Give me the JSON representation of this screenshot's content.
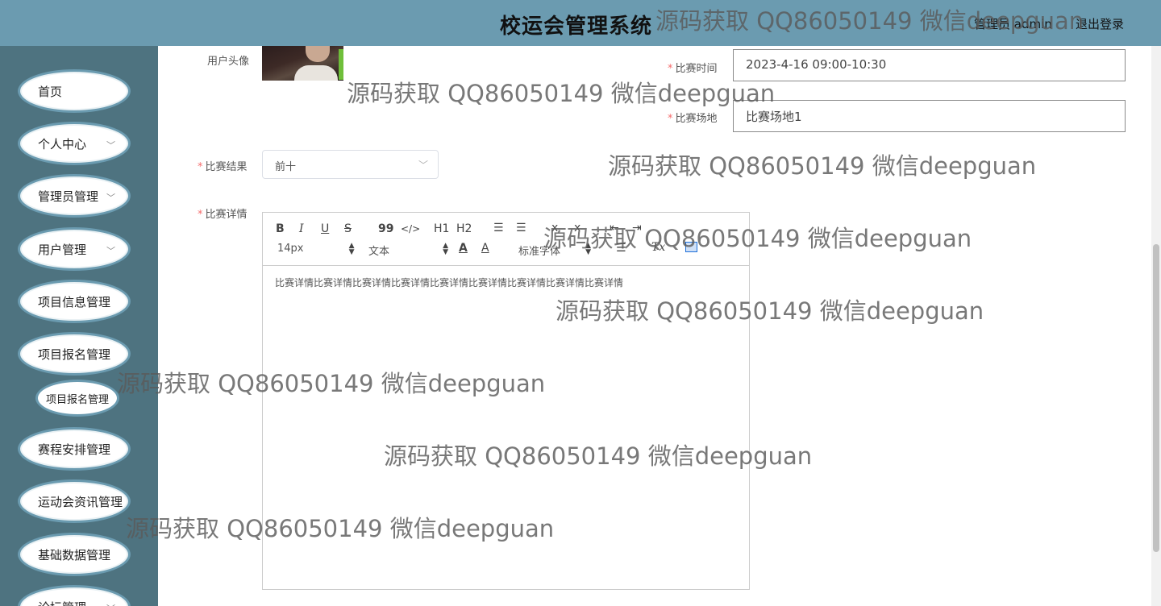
{
  "header": {
    "title": "校运会管理系统",
    "user": "管理员 admin",
    "logout": "退出登录"
  },
  "sidebar": {
    "items": [
      {
        "label": "首页",
        "chevron": ""
      },
      {
        "label": "个人中心",
        "chevron": "﹀"
      },
      {
        "label": "管理员管理",
        "chevron": "﹀"
      },
      {
        "label": "用户管理",
        "chevron": "﹀"
      },
      {
        "label": "项目信息管理",
        "chevron": ""
      },
      {
        "label": "项目报名管理",
        "chevron": ""
      },
      {
        "label": "赛程安排管理",
        "chevron": ""
      },
      {
        "label": "运动会资讯管理",
        "chevron": ""
      },
      {
        "label": "基础数据管理",
        "chevron": ""
      },
      {
        "label": "论坛管理",
        "chevron": "﹀"
      }
    ],
    "subitem": "项目报名管理"
  },
  "form": {
    "avatar_label": "用户头像",
    "time_label": "比赛时间",
    "time_value": "2023-4-16 09:00-10:30",
    "venue_label": "比赛场地",
    "venue_value": "比赛场地1",
    "result_label": "比赛结果",
    "result_value": "前十",
    "detail_label": "比赛详情",
    "required_mark": "*"
  },
  "editor": {
    "toolbar": {
      "bold": "B",
      "italic": "I",
      "underline": "U",
      "strike": "S",
      "quote": "99",
      "code": "</>",
      "h1": "H1",
      "h2": "H2",
      "font_size": "14px",
      "paragraph": "文本",
      "font_family": "标准字体",
      "color": "A",
      "bg_color": "A",
      "clear": "Tx"
    },
    "content": "比赛详情比赛详情比赛详情比赛详情比赛详情比赛详情比赛详情比赛详情比赛详情"
  },
  "watermark": "源码获取 QQ86050149 微信deepguan"
}
